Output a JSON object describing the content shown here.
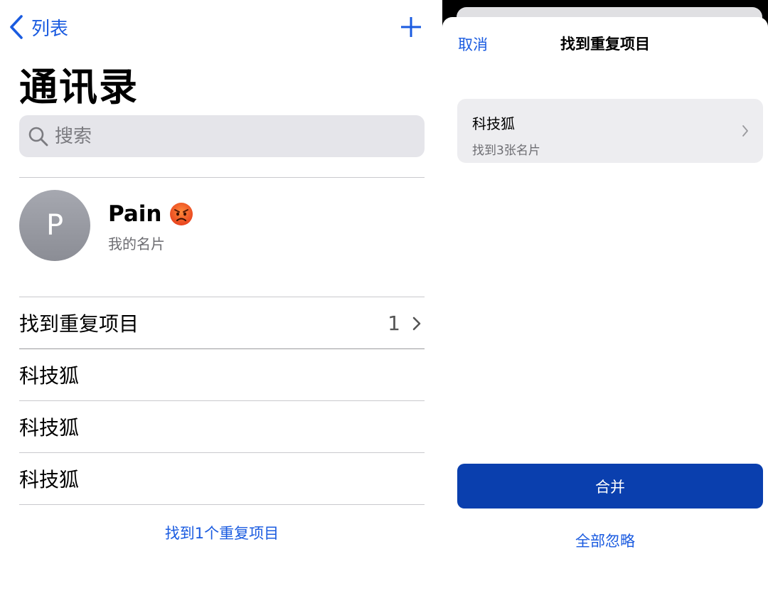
{
  "colors": {
    "accent": "#1a5be0",
    "merge_button": "#0a3fae",
    "avatar": "#9a9ca3"
  },
  "left": {
    "nav": {
      "back_label": "列表",
      "back_icon": "chevron-left-icon",
      "add_icon": "plus-icon"
    },
    "title": "通讯录",
    "search": {
      "placeholder": "搜索",
      "icon": "search-icon"
    },
    "my_card": {
      "initial": "P",
      "name": "Pain",
      "emoji": "angry-face-icon",
      "subtitle": "我的名片"
    },
    "duplicates_row": {
      "label": "找到重复项目",
      "count": "1"
    },
    "contacts": [
      {
        "name": "科技狐"
      },
      {
        "name": "科技狐"
      },
      {
        "name": "科技狐"
      }
    ],
    "footer": "找到1个重复项目"
  },
  "right": {
    "cancel": "取消",
    "title": "找到重复项目",
    "duplicate": {
      "name": "科技狐",
      "detail": "找到3张名片"
    },
    "merge": "合并",
    "ignore_all": "全部忽略"
  }
}
